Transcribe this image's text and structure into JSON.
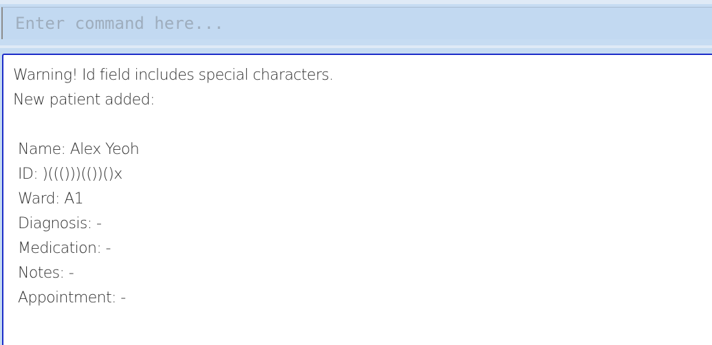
{
  "command_box": {
    "value": "",
    "placeholder": "Enter command here..."
  },
  "result_display": {
    "warning": "Warning! Id field includes special characters.",
    "status": "New patient added:",
    "patient": [
      {
        "label": "Name",
        "value": "Alex Yeoh",
        "text": "Name: Alex Yeoh"
      },
      {
        "label": "ID",
        "value": ")((()))(())()x",
        "text": "ID: )((()))(())()x"
      },
      {
        "label": "Ward",
        "value": "A1",
        "text": "Ward: A1"
      },
      {
        "label": "Diagnosis",
        "value": "-",
        "text": "Diagnosis: -"
      },
      {
        "label": "Medication",
        "value": "-",
        "text": "Medication: -"
      },
      {
        "label": "Notes",
        "value": "-",
        "text": "Notes: -"
      },
      {
        "label": "Appointment",
        "value": "-",
        "text": "Appointment: -"
      }
    ]
  },
  "colors": {
    "command_background": "#c2d9f1",
    "result_border": "#1a2bc8",
    "result_background": "#ffffff"
  }
}
